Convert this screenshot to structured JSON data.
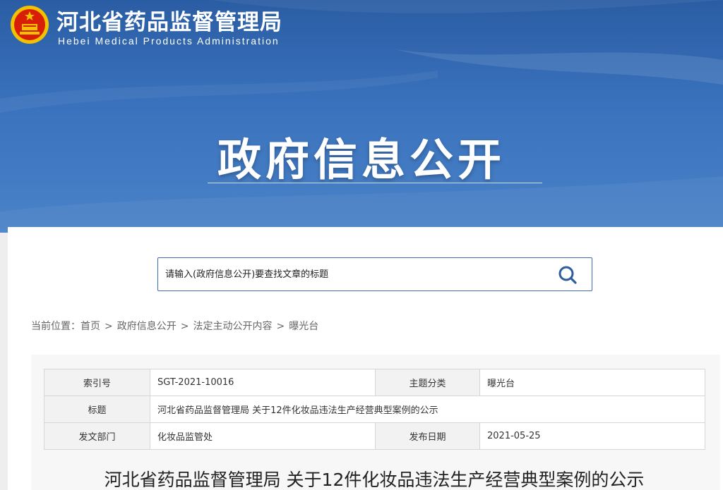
{
  "header": {
    "site_title": "河北省药品监督管理局",
    "site_subtitle": "Hebei Medical Products Administration",
    "emblem_icon": "national-emblem-icon",
    "section_title": "政府信息公开",
    "colors": {
      "banner_top": "#2a5da3",
      "banner_bottom": "#4a83c8",
      "accent": "#3b6cb5"
    }
  },
  "search": {
    "placeholder": "请输入(政府信息公开)要查找文章的标题",
    "icon": "search-icon"
  },
  "breadcrumb": {
    "prefix": "当前位置：",
    "items": [
      "首页",
      "政府信息公开",
      "法定主动公开内容",
      "曝光台"
    ],
    "separator": ">"
  },
  "meta": {
    "index_label": "索引号",
    "index_value": "SGT-2021-10016",
    "category_label": "主题分类",
    "category_value": "曝光台",
    "title_label": "标题",
    "title_value": "河北省药品监督管理局 关于12件化妆品违法生产经营典型案例的公示",
    "dept_label": "发文部门",
    "dept_value": "化妆品监管处",
    "date_label": "发布日期",
    "date_value": "2021-05-25"
  },
  "article": {
    "title": "河北省药品监督管理局 关于12件化妆品违法生产经营典型案例的公示"
  }
}
